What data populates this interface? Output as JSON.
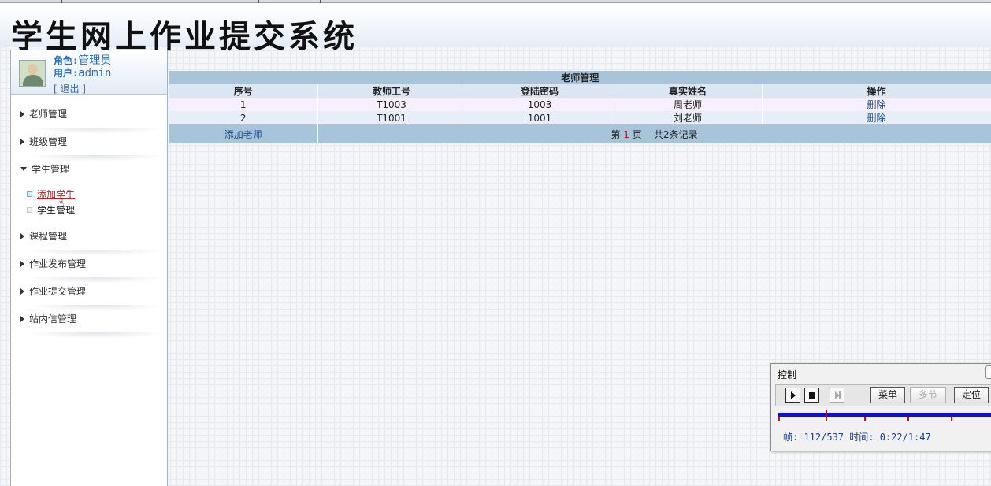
{
  "app": {
    "title": "学生网上作业提交系统"
  },
  "user": {
    "role_label": "角色:",
    "role": "管理员",
    "user_label": "用户:",
    "username": "admin",
    "logout": "[ 退出 ]"
  },
  "sidebar": {
    "items": [
      {
        "label": "老师管理"
      },
      {
        "label": "班级管理"
      },
      {
        "label": "学生管理"
      },
      {
        "label": "课程管理"
      },
      {
        "label": "作业发布管理"
      },
      {
        "label": "作业提交管理"
      },
      {
        "label": "站内信管理"
      }
    ],
    "sub_items": [
      {
        "label": "添加学生",
        "active": true
      },
      {
        "label": "学生管理",
        "active": false
      }
    ]
  },
  "table": {
    "caption": "老师管理",
    "headers": [
      "序号",
      "教师工号",
      "登陆密码",
      "真实姓名",
      "操作"
    ],
    "rows": [
      {
        "no": "1",
        "id": "T1003",
        "password": "1003",
        "name": "周老师",
        "action": "删除"
      },
      {
        "no": "2",
        "id": "T1001",
        "password": "1001",
        "name": "刘老师",
        "action": "删除"
      }
    ],
    "add_link": "添加老师",
    "pager": {
      "prefix": "第",
      "page": "1",
      "suffix": "页",
      "total": "共2条记录"
    }
  },
  "control_panel": {
    "title": "控制",
    "menu_button": "菜单",
    "multi_button": "多节",
    "locate_button": "定位",
    "frame_info": "帧: 112/537 时间: 0:22/1:47",
    "progress_fraction": 0.209
  },
  "icons": {
    "play": "play-icon",
    "stop": "stop-icon",
    "next": "next-frame-icon",
    "close": "close-icon",
    "avatar": "user-avatar"
  }
}
